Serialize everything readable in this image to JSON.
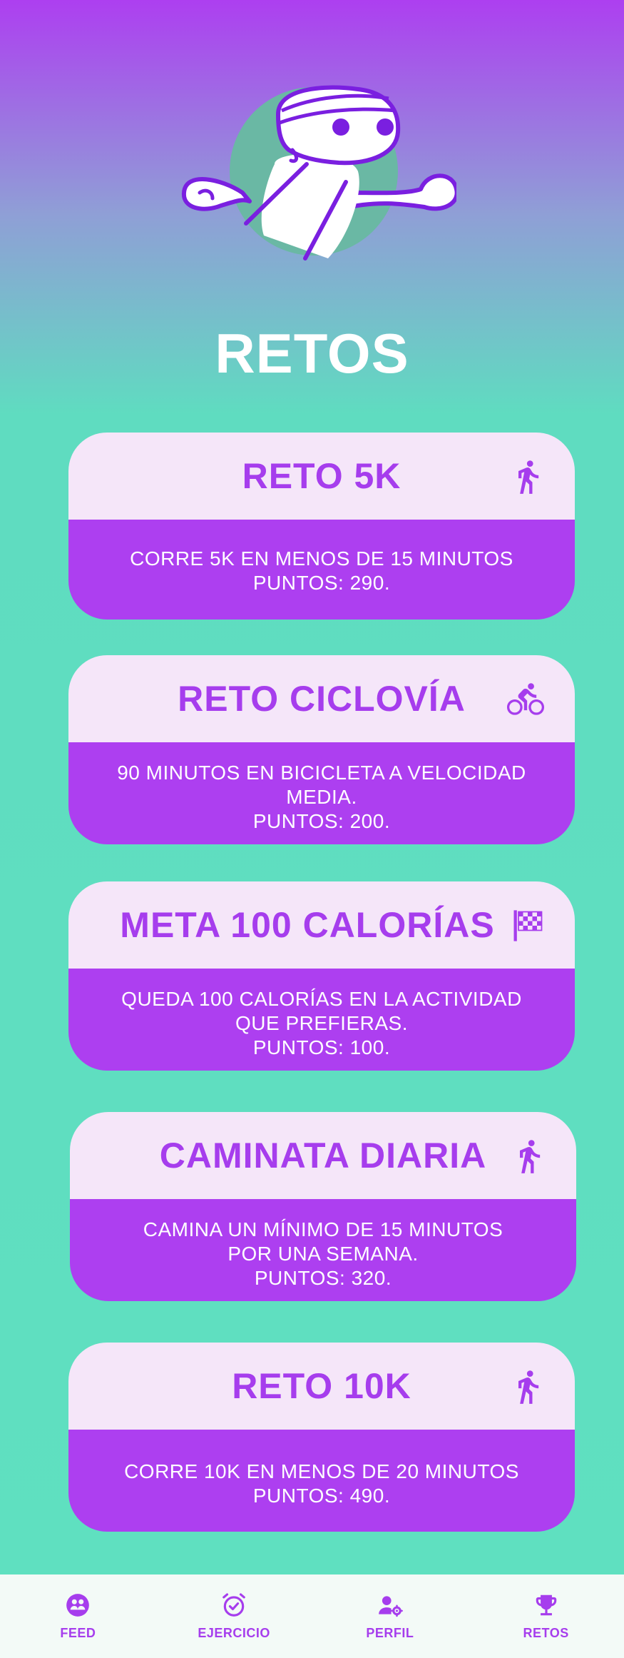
{
  "colors": {
    "accent": "#ad3ff0",
    "card_header_bg": "#f5e6f9",
    "title_text": "#a63ded",
    "background_top": "#ad3ff0",
    "background_bottom": "#5fe0c0",
    "nav_bg": "#f3faf7"
  },
  "page": {
    "title": "RETOS"
  },
  "hero": {
    "icon": "runner-mascot-illustration"
  },
  "challenges": [
    {
      "title": "RETO 5K",
      "icon": "running-icon",
      "lines": [
        "CORRE 5K EN MENOS DE 15 MINUTOS",
        "PUNTOS: 290."
      ]
    },
    {
      "title": "RETO CICLOVÍA",
      "icon": "bicycle-icon",
      "lines": [
        "90 MINUTOS EN BICICLETA A VELOCIDAD",
        "MEDIA.",
        "PUNTOS: 200."
      ]
    },
    {
      "title": "META 100 CALORÍAS",
      "icon": "checkered-flag-icon",
      "lines": [
        "QUEDA 100 CALORÍAS EN LA ACTIVIDAD",
        "QUE PREFIERAS.",
        "PUNTOS: 100."
      ]
    },
    {
      "title": "CAMINATA DIARIA",
      "icon": "running-icon",
      "lines": [
        "CAMINA UN MÍNIMO DE 15 MINUTOS",
        "POR UNA SEMANA.",
        "PUNTOS: 320."
      ]
    },
    {
      "title": "RETO 10K",
      "icon": "running-icon",
      "lines": [
        "CORRE 10K EN MENOS DE 20 MINUTOS",
        "PUNTOS: 490."
      ]
    }
  ],
  "nav": {
    "items": [
      {
        "label": "FEED",
        "icon": "group-icon"
      },
      {
        "label": "EJERCICIO",
        "icon": "alarm-check-icon"
      },
      {
        "label": "PERFIL",
        "icon": "user-settings-icon"
      },
      {
        "label": "RETOS",
        "icon": "trophy-icon"
      }
    ]
  }
}
